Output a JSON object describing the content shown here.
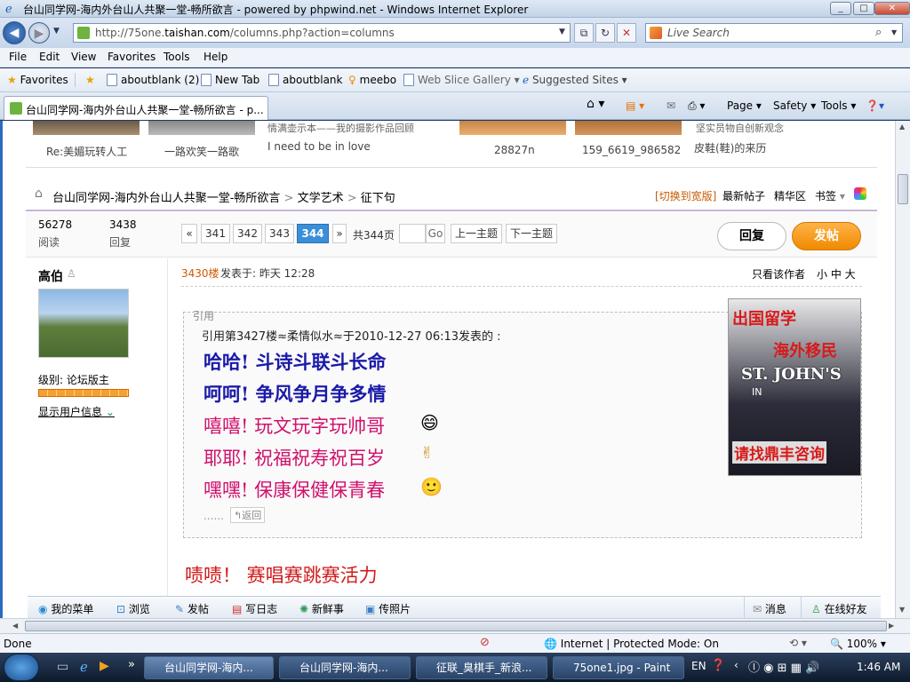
{
  "window": {
    "title": "台山同学网-海内外台山人共聚一堂-畅所欲言 - powered by phpwind.net - Windows Internet Explorer",
    "min": "_",
    "max": "□",
    "close": "✕"
  },
  "address": {
    "url_prefix": "http://75one.",
    "url_domain": "taishan.com",
    "url_suffix": "/columns.php?action=columns",
    "search_placeholder": "Live Search"
  },
  "menu": [
    "File",
    "Edit",
    "View",
    "Favorites",
    "Tools",
    "Help"
  ],
  "favorites": {
    "label": "Favorites",
    "items": [
      "aboutblank (2)",
      "New Tab",
      "aboutblank",
      "meebo",
      "Web Slice Gallery",
      "Suggested Sites"
    ]
  },
  "tab": {
    "title": "台山同学网-海内外台山人共聚一堂-畅所欲言 - p..."
  },
  "commandbar": [
    "Page",
    "Safety",
    "Tools"
  ],
  "thumbs": {
    "row1": [
      "Re:美媚玩转人工",
      "一路欢笑一路歌",
      "I need to be in love",
      "28827n",
      "159_6619_986582",
      "皮鞋(鞋)的来历"
    ],
    "top_partial": [
      "情满壶示本——我的摄影作品回顾",
      "坚实员物自创新观念"
    ]
  },
  "breadcrumb": {
    "items": [
      "台山同学网-海内外台山人共聚一堂-畅所欲言",
      "文学艺术",
      "征下句"
    ],
    "sep": ">",
    "wide": "[切换到宽版]",
    "latest": "最新帖子",
    "digest": "精华区",
    "bookmark": "书签"
  },
  "stats": {
    "views": "56278",
    "views_label": "阅读",
    "replies": "3438",
    "replies_label": "回复"
  },
  "pagination": {
    "prev": "«",
    "pages": [
      "341",
      "342",
      "343",
      "344"
    ],
    "current": "344",
    "next": "»",
    "total": "共344页",
    "go": "Go",
    "prev_topic": "上一主题",
    "next_topic": "下一主题"
  },
  "actions": {
    "reply": "回复",
    "post": "发帖"
  },
  "user": {
    "name": "高伯",
    "level_label": "级别: 论坛版主",
    "show_info": "显示用户信息"
  },
  "post": {
    "floor": "3430楼",
    "posted": "发表于: 昨天 12:28",
    "author_only": "只看该作者",
    "sizes": "小 中 大",
    "quote_label": "引用",
    "quote_header": "引用第3427楼≈柔情似水≈于2010-12-27 06:13发表的 :",
    "lines": [
      {
        "text": "哈哈! 斗诗斗联斗长命",
        "color": "#1a1aa8",
        "emoji": ""
      },
      {
        "text": "呵呵! 争风争月争多情",
        "color": "#1a1aa8",
        "emoji": ""
      },
      {
        "text": "嘻嘻! 玩文玩字玩帅哥",
        "color": "#d0106b",
        "emoji": "😄"
      },
      {
        "text": "耶耶! 祝福祝寿祝百岁",
        "color": "#d0106b",
        "emoji": "✌"
      },
      {
        "text": "嘿嘿! 保康保健保青春",
        "color": "#d0106b",
        "emoji": "🙂"
      }
    ],
    "back": "↰返回",
    "reply_line": "啧啧！ 赛唱赛跳赛活力",
    "reply_color": "#d11a1a"
  },
  "ad": {
    "line1": "出国留学",
    "line2": "海外移民",
    "school": "ST. JOHN'S",
    "partial": "IN",
    "cta": "请找鼎丰咨询"
  },
  "bottombar": {
    "items": [
      "我的菜单",
      "浏览",
      "发帖",
      "写日志",
      "新鲜事",
      "传照片"
    ],
    "msg": "消息",
    "online": "在线好友"
  },
  "status": {
    "done": "Done",
    "zone": "Internet | Protected Mode: On",
    "zoom": "100%"
  },
  "taskbar": {
    "tasks": [
      "台山同学网-海内...",
      "台山同学网-海内...",
      "征联_臭棋手_新浪...",
      "75one1.jpg - Paint"
    ],
    "lang": "EN",
    "time": "1:46 AM"
  }
}
